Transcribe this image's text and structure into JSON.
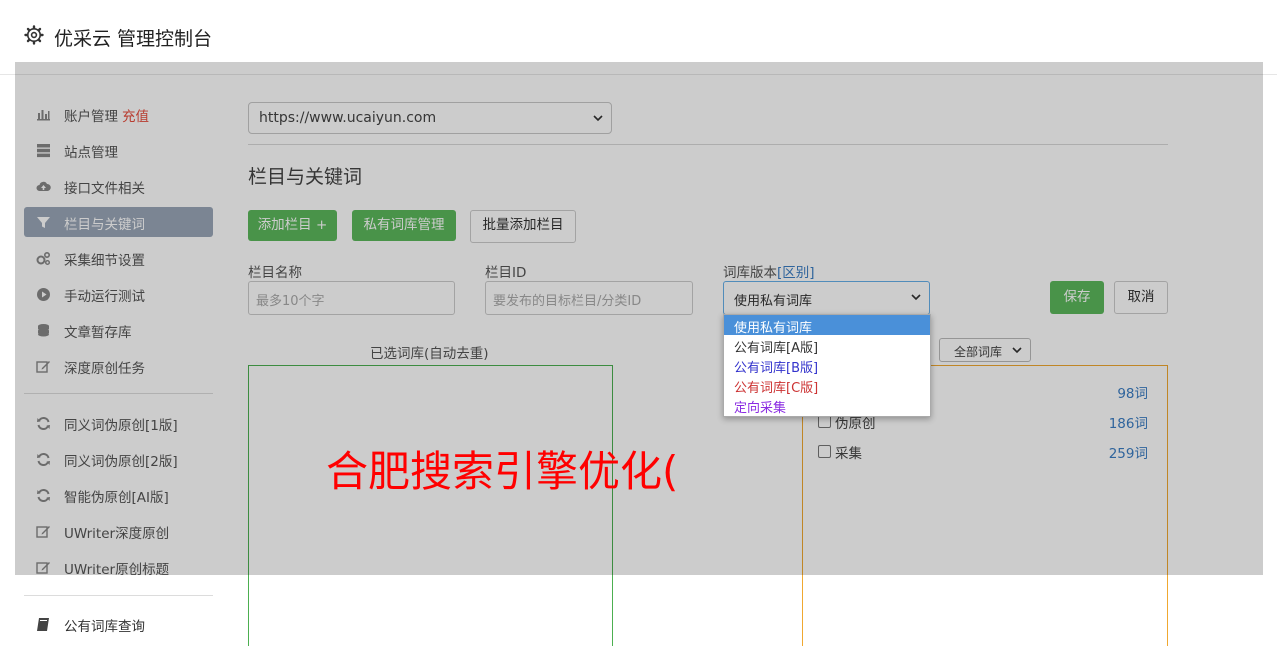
{
  "header": {
    "icon": "gear-icon",
    "title": "优采云 管理控制台"
  },
  "sidebar": {
    "items": [
      {
        "label": "账户管理",
        "icon": "bar-chart-icon",
        "extra": "充值"
      },
      {
        "label": "站点管理",
        "icon": "server-icon"
      },
      {
        "label": "接口文件相关",
        "icon": "cloud-upload-icon"
      },
      {
        "label": "栏目与关键词",
        "icon": "filter-icon",
        "active": true
      },
      {
        "label": "采集细节设置",
        "icon": "cogs-icon"
      },
      {
        "label": "手动运行测试",
        "icon": "play-circle-icon"
      },
      {
        "label": "文章暂存库",
        "icon": "database-icon"
      },
      {
        "label": "深度原创任务",
        "icon": "edit-icon"
      },
      {
        "label": "同义词伪原创[1版]",
        "icon": "refresh-icon"
      },
      {
        "label": "同义词伪原创[2版]",
        "icon": "refresh-icon"
      },
      {
        "label": "智能伪原创[AI版]",
        "icon": "refresh-icon"
      },
      {
        "label": "UWriter深度原创",
        "icon": "edit-icon"
      },
      {
        "label": "UWriter原创标题",
        "icon": "edit-icon"
      },
      {
        "label": "公有词库查询",
        "icon": "book-icon"
      }
    ]
  },
  "main": {
    "site_select": "https://www.ucaiyun.com",
    "section_title": "栏目与关键词",
    "buttons": {
      "add_column": "添加栏目 +",
      "private_lib": "私有词库管理",
      "batch_add": "批量添加栏目",
      "save": "保存",
      "cancel": "取消"
    },
    "fields": {
      "name_label": "栏目名称",
      "name_placeholder": "最多10个字",
      "id_label": "栏目ID",
      "id_placeholder": "要发布的目标栏目/分类ID",
      "version_label": "词库版本",
      "version_link": "[区别]",
      "version_value": "使用私有词库"
    },
    "selected_lib_label": "已选词库(自动去重)",
    "filter_select": "全部词库",
    "library_rows": [
      {
        "name": "",
        "count": "98词"
      },
      {
        "name": "伪原创",
        "count": "186词"
      },
      {
        "name": "采集",
        "count": "259词"
      }
    ]
  },
  "dropdown": {
    "options": [
      {
        "label": "使用私有词库",
        "color": "#ffffff",
        "highlighted": true
      },
      {
        "label": "公有词库[A版]",
        "color": "#333333"
      },
      {
        "label": "公有词库[B版]",
        "color": "#3333cc"
      },
      {
        "label": "公有词库[C版]",
        "color": "#cc3333"
      },
      {
        "label": "定向采集",
        "color": "#8a2be2"
      }
    ]
  },
  "watermark": "合肥搜索引擎优化("
}
